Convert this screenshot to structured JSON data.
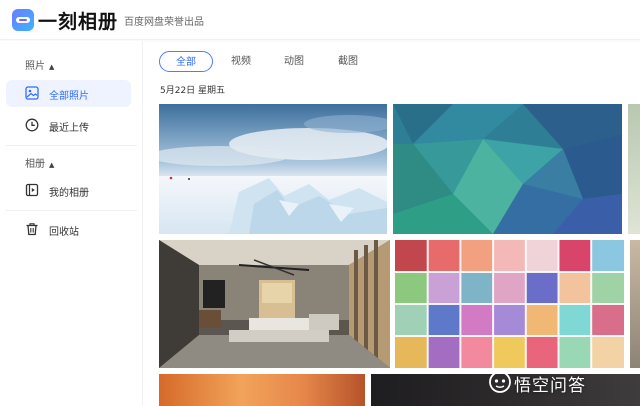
{
  "header": {
    "brand": "一刻相册",
    "subtitle": "百度网盘荣誉出品"
  },
  "sidebar": {
    "photos_section": "照片",
    "albums_section": "相册",
    "items": [
      {
        "label": "全部照片",
        "icon": "image-icon",
        "active": true
      },
      {
        "label": "最近上传",
        "icon": "clock-icon",
        "active": false
      },
      {
        "label": "我的相册",
        "icon": "album-icon",
        "active": false
      },
      {
        "label": "回收站",
        "icon": "trash-icon",
        "active": false
      }
    ]
  },
  "tabs": [
    {
      "label": "全部",
      "active": true
    },
    {
      "label": "视频",
      "active": false
    },
    {
      "label": "动图",
      "active": false
    },
    {
      "label": "截图",
      "active": false
    }
  ],
  "date_group": "5月22日 星期五",
  "watermark": "悟空问答",
  "colors": {
    "accent": "#2f6bff",
    "active_bg": "#eef3ff"
  }
}
